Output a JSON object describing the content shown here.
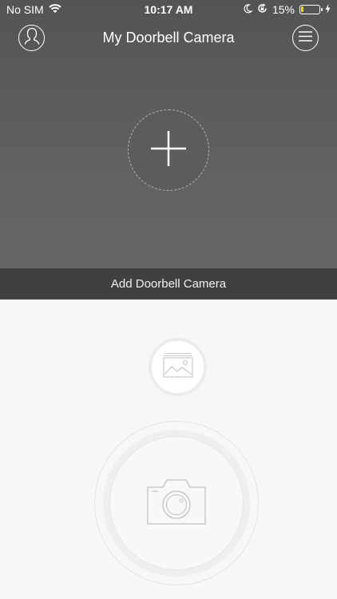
{
  "status_bar": {
    "carrier": "No SIM",
    "time": "10:17 AM",
    "battery_percent": "15%",
    "battery_level": 0.15,
    "icons": [
      "wifi-icon",
      "moon-icon",
      "rotation-lock-icon",
      "battery-icon",
      "charging-bolt-icon"
    ]
  },
  "header": {
    "title": "My Doorbell Camera",
    "left_icon": "profile-icon",
    "right_icon": "menu-icon"
  },
  "main": {
    "add_icon": "plus-icon",
    "add_label": "Add Doorbell Camera"
  },
  "bottom": {
    "gallery_icon": "gallery-icon",
    "shutter_icon": "camera-icon"
  },
  "colors": {
    "top_background": "#5e5e5e",
    "add_bar": "#404040",
    "bottom_background": "#f7f7f7",
    "battery_fill": "#f5d60a"
  }
}
